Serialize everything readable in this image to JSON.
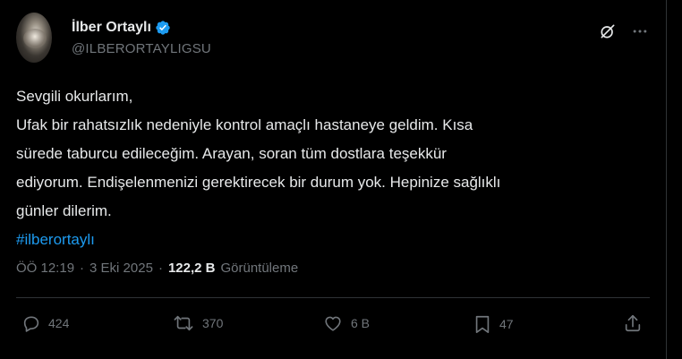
{
  "colors": {
    "background": "#000000",
    "text": "#e7e9ea",
    "secondary_text": "#71767b",
    "link": "#1d9bf0",
    "divider": "#2f3336",
    "verified_badge": "#1d9bf0"
  },
  "author": {
    "display_name": "İlber Ortaylı",
    "handle": "@ILBERORTAYLIGSU",
    "verified": true,
    "avatar_icon": "profile-photo"
  },
  "header_actions": {
    "grok_icon": "grok-icon",
    "more_icon": "more-options-icon"
  },
  "tweet": {
    "lines": [
      "Sevgili okurlarım,",
      "Ufak bir rahatsızlık nedeniyle kontrol amaçlı hastaneye geldim. Kısa",
      "sürede taburcu edileceğim. Arayan, soran tüm dostlara teşekkür",
      "ediyorum. Endişelenmenizi gerektirecek bir durum yok. Hepinize sağlıklı",
      "günler dilerim."
    ],
    "hashtag": "#ilberortaylı"
  },
  "meta": {
    "time": "ÖÖ 12:19",
    "separator": "·",
    "date": "3 Eki 2025",
    "views_count": "122,2 B",
    "views_label": "Görüntüleme"
  },
  "actions": {
    "replies": {
      "icon": "reply-icon",
      "count": "424"
    },
    "reposts": {
      "icon": "repost-icon",
      "count": "370"
    },
    "likes": {
      "icon": "like-icon",
      "count": "6 B"
    },
    "bookmarks": {
      "icon": "bookmark-icon",
      "count": "47"
    },
    "share": {
      "icon": "share-icon"
    }
  }
}
